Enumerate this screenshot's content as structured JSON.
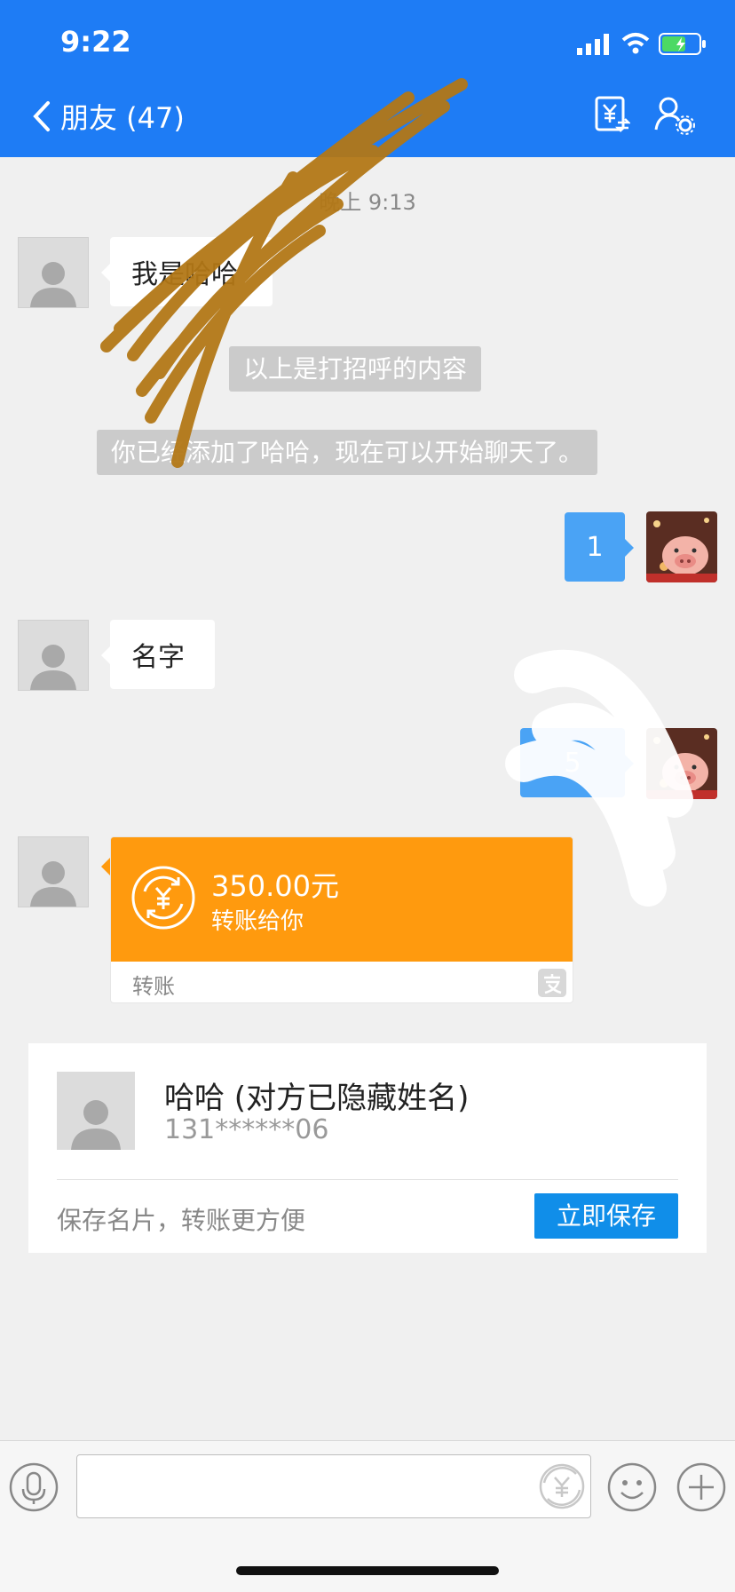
{
  "status_bar": {
    "time": "9:22"
  },
  "header": {
    "back_label": "朋友 (47)"
  },
  "chat": {
    "timestamp": "晚上 9:13",
    "msg1": "我是哈哈",
    "sys1": "以上是打招呼的内容",
    "sys2": "你已经添加了哈哈，现在可以开始聊天了。",
    "my_msg1": "1",
    "msg2": "名字",
    "my_msg2": "5"
  },
  "transfer": {
    "amount": "350.00元",
    "subtitle": "转账给你",
    "footer": "转账"
  },
  "contact_card": {
    "name": "哈哈 (对方已隐藏姓名)",
    "phone": "131******06",
    "hint": "保存名片，转账更方便",
    "save_label": "立即保存"
  },
  "colors": {
    "header": "#1e7cf5",
    "transfer": "#ff9a0e",
    "sent_bubble": "#4aa3f5",
    "save_button": "#108ee9"
  }
}
